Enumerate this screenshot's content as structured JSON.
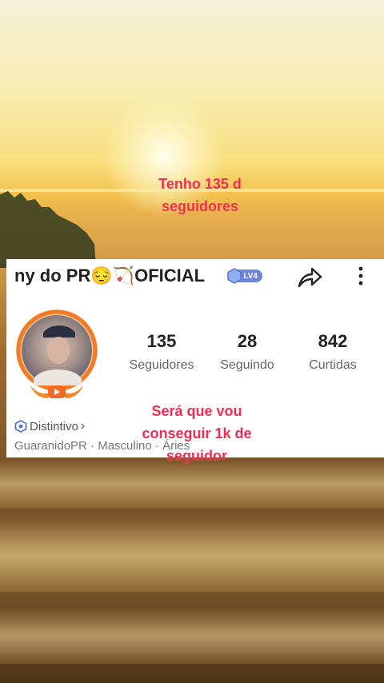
{
  "overlay": {
    "top_line1": "Tenho 135 d",
    "top_line2": "seguidores",
    "mid_line1": "Será que vou",
    "mid_line2": "conseguir 1k de",
    "mid_line3": "seguidor"
  },
  "profile": {
    "name": "ny do PR😔🏹OFICIAL",
    "level_badge": "LV4",
    "share_icon": "share-arrow-icon",
    "more_icon": "vertical-dots-icon",
    "stats": [
      {
        "value": "135",
        "label": "Seguidores"
      },
      {
        "value": "28",
        "label": "Seguindo"
      },
      {
        "value": "842",
        "label": "Curtidas"
      }
    ],
    "badge_label": "Distintivo",
    "badge_chevron": "›",
    "info": "GuaranidoPR · Masculino · Áries"
  },
  "colors": {
    "overlay_text": "#ef2f52",
    "level_badge": "#6d87d6",
    "avatar_ring": "#f07a2a"
  }
}
